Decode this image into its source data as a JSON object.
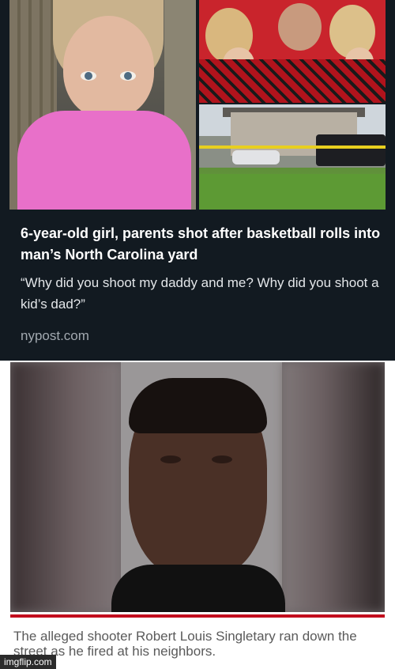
{
  "preview_card": {
    "headline": "6-year-old girl, parents shot after basketball rolls into man’s North Carolina yard",
    "quote": "“Why did you shoot my daddy and me? Why did you shoot a kid’s dad?”",
    "source": "nypost.com",
    "background": "#121a21"
  },
  "article": {
    "caption": "The alleged shooter Robert Louis Singletary ran down the street as he fired at his neighbors.",
    "rule_color": "#c20d1d"
  },
  "watermark": "imgflip.com"
}
